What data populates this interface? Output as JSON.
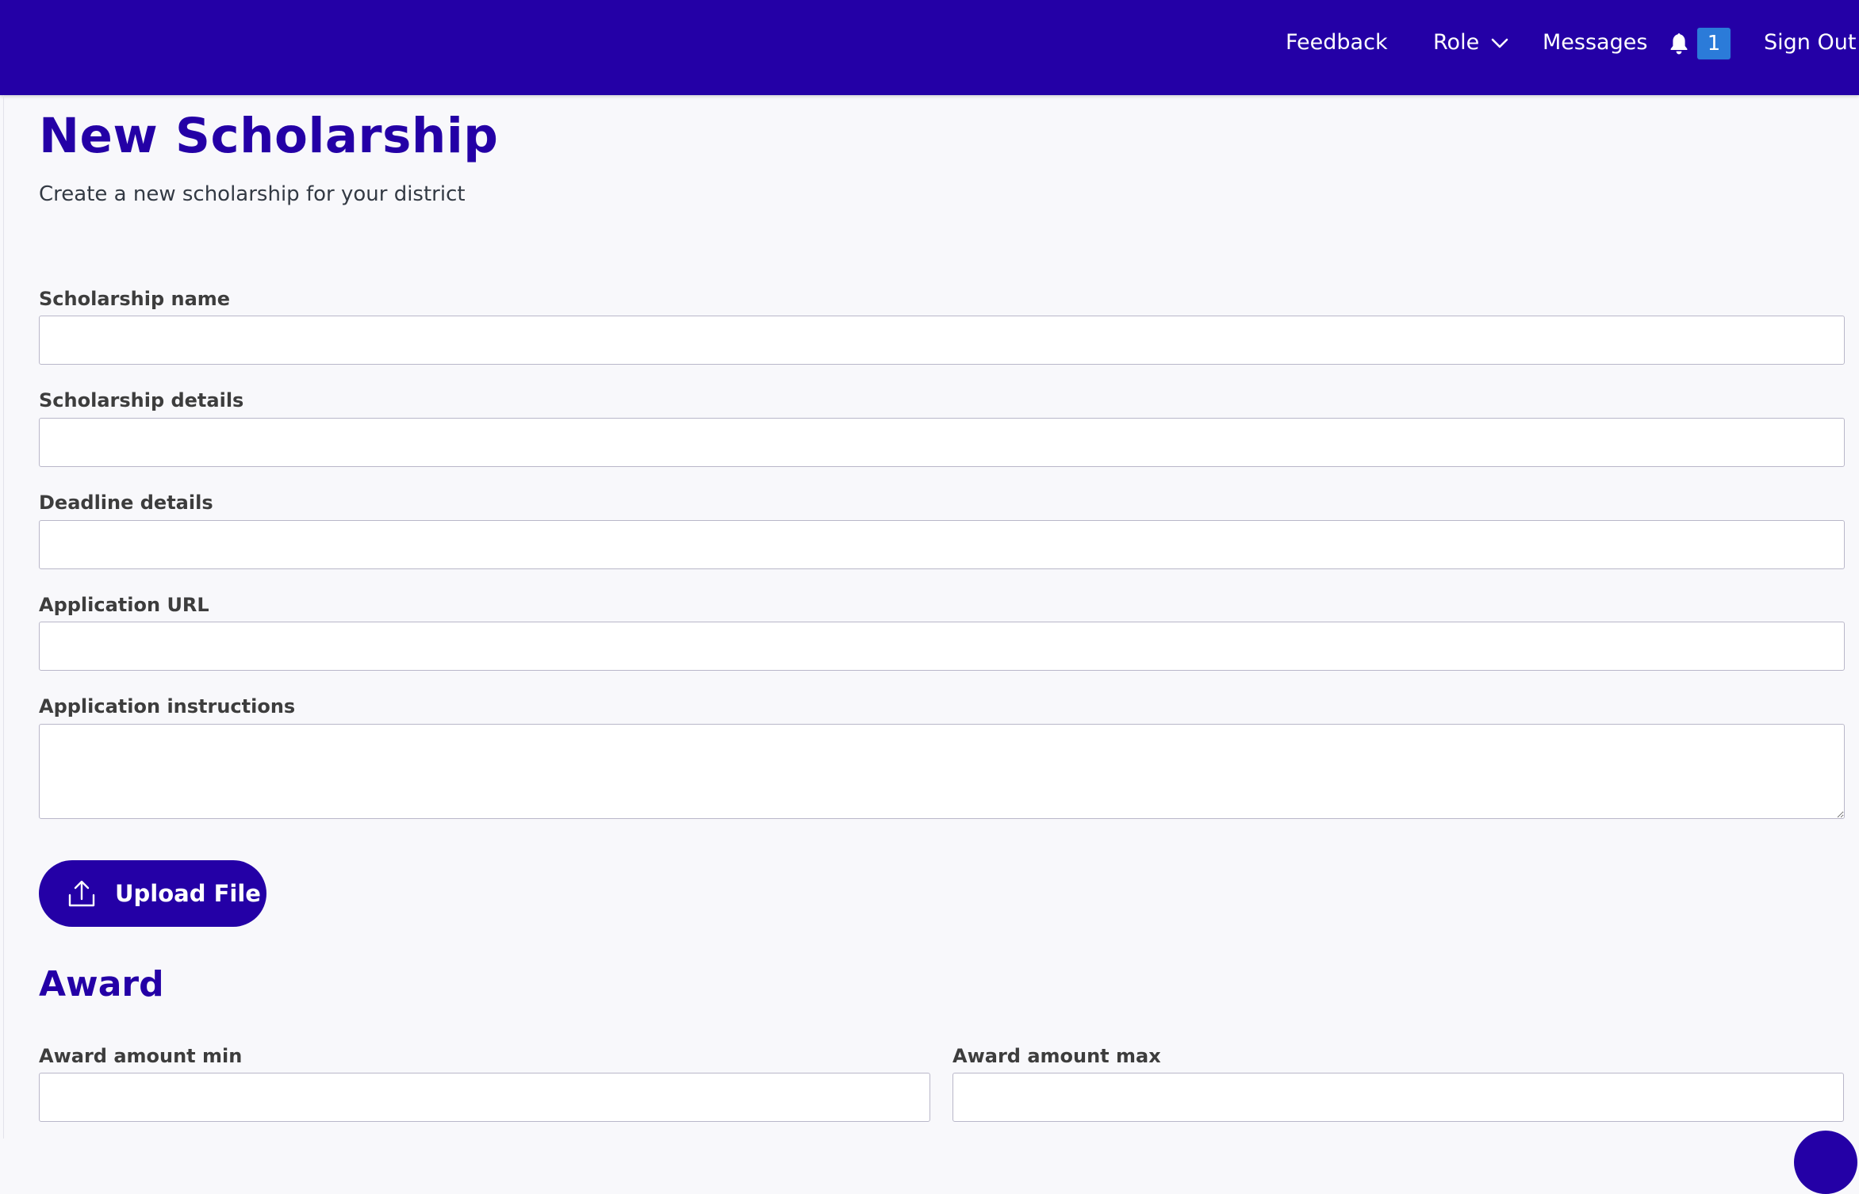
{
  "colors": {
    "brand": "#2400a6",
    "badge": "#2b7bd9",
    "background": "#f8f8fb",
    "label": "#3d3d3d",
    "input_border": "#b9b7c9"
  },
  "nav": {
    "feedback": "Feedback",
    "role": "Role",
    "messages": "Messages",
    "notification_count": "1",
    "sign_out": "Sign Out",
    "icons": {
      "role_chevron": "chevron-down-icon",
      "notifications": "bell-icon"
    }
  },
  "page": {
    "title": "New Scholarship",
    "subtitle": "Create a new scholarship for your district"
  },
  "form": {
    "scholarship_name": {
      "label": "Scholarship name",
      "value": ""
    },
    "scholarship_details": {
      "label": "Scholarship details",
      "value": ""
    },
    "deadline_details": {
      "label": "Deadline details",
      "value": ""
    },
    "application_url": {
      "label": "Application URL",
      "value": ""
    },
    "application_instructions": {
      "label": "Application instructions",
      "value": ""
    },
    "upload_button": {
      "label": "Upload File",
      "icon": "upload-icon"
    }
  },
  "award": {
    "heading": "Award",
    "min": {
      "label": "Award amount min",
      "value": ""
    },
    "max": {
      "label": "Award amount max",
      "value": ""
    }
  }
}
